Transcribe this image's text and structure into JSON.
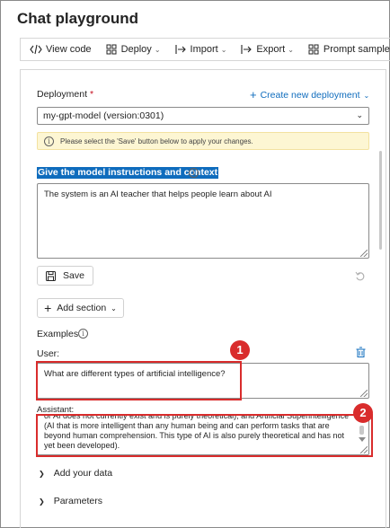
{
  "page": {
    "title": "Chat playground"
  },
  "toolbar": {
    "view_code": "View code",
    "deploy": "Deploy",
    "import": "Import",
    "export": "Export",
    "prompt_samples": "Prompt samples"
  },
  "deployment": {
    "label": "Deployment",
    "required_mark": "*",
    "create_new": "Create new deployment",
    "selected": "my-gpt-model (version:0301)",
    "notice": "Please select the 'Save' button below to apply your changes."
  },
  "system": {
    "label": "Give the model instructions and context",
    "message": "The system is an AI teacher that helps people learn about AI",
    "save_label": "Save",
    "add_section_label": "Add section"
  },
  "examples": {
    "heading": "Examples",
    "user_label": "User:",
    "user_message": "What are different types of artificial intelligence?",
    "assistant_label": "Assistant:",
    "assistant_message": "or AI does not currently exist and is purely theoretical); and Artificial Superintelligence (AI that is more intelligent than any human being and can perform tasks that are beyond human comprehension. This type of AI is also purely theoretical and has not yet been developed)."
  },
  "callouts": [
    "1",
    "2"
  ],
  "sections": {
    "add_your_data": "Add your data",
    "parameters": "Parameters"
  },
  "colors": {
    "accent": "#0f6cbd",
    "callout": "#d92c2c",
    "notice_bg": "#fdf6d3"
  }
}
